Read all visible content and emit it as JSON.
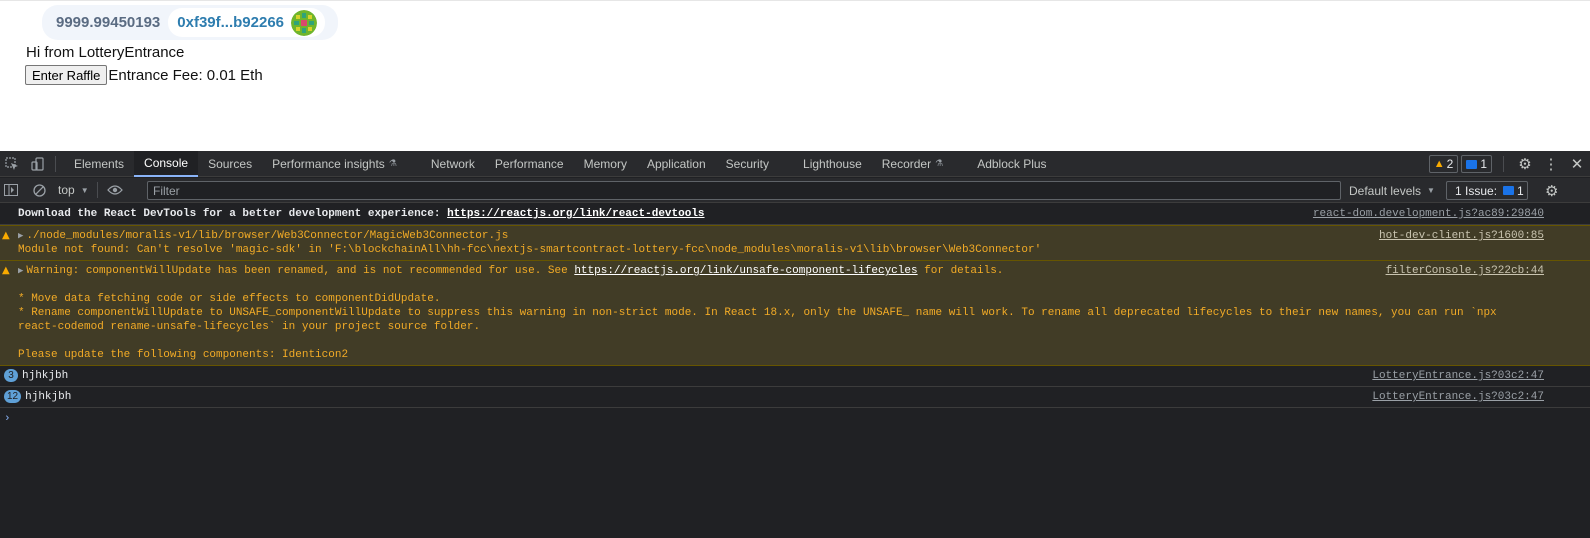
{
  "page": {
    "wallet": {
      "balance": "9999.99450193",
      "address": "0xf39f...b92266"
    },
    "greeting": "Hi from LotteryEntrance",
    "enter_button": "Enter Raffle",
    "entrance_fee": "Entrance Fee: 0.01 Eth"
  },
  "devtools": {
    "tabs": [
      "Elements",
      "Console",
      "Sources",
      "Performance insights",
      "Network",
      "Performance",
      "Memory",
      "Application",
      "Security",
      "Lighthouse",
      "Recorder",
      "Adblock Plus"
    ],
    "active_tab": "Console",
    "warnings_count": "2",
    "messages_count": "1",
    "toolbar": {
      "context": "top",
      "filter_placeholder": "Filter",
      "levels": "Default levels",
      "issues_label": "1 Issue:",
      "issues_count": "1"
    },
    "console": {
      "react_devtools": {
        "text": "Download the React DevTools for a better development experience: ",
        "link": "https://reactjs.org/link/react-devtools",
        "source": "react-dom.development.js?ac89:29840"
      },
      "module_warning": {
        "line1": "./node_modules/moralis-v1/lib/browser/Web3Connector/MagicWeb3Connector.js",
        "line2": "Module not found: Can't resolve 'magic-sdk' in 'F:\\blockchainAll\\hh-fcc\\nextjs-smartcontract-lottery-fcc\\node_modules\\moralis-v1\\lib\\browser\\Web3Connector'",
        "source": "hot-dev-client.js?1600:85"
      },
      "lifecycle_warning": {
        "prefix": "Warning: componentWillUpdate has been renamed, and is not recommended for use. See ",
        "link": "https://reactjs.org/link/unsafe-component-lifecycles",
        "suffix": " for details.",
        "body": "\n* Move data fetching code or side effects to componentDidUpdate.\n* Rename componentWillUpdate to UNSAFE_componentWillUpdate to suppress this warning in non-strict mode. In React 18.x, only the UNSAFE_ name will work. To rename all deprecated lifecycles to their new names, you can run `npx react-codemod rename-unsafe-lifecycles` in your project source folder.\n\nPlease update the following components: Identicon2",
        "source": "filterConsole.js?22cb:44"
      },
      "logs": [
        {
          "count": "3",
          "text": "hjhkjbh",
          "source": "LotteryEntrance.js?03c2:47"
        },
        {
          "count": "12",
          "text": "hjhkjbh",
          "source": "LotteryEntrance.js?03c2:47"
        }
      ]
    }
  }
}
